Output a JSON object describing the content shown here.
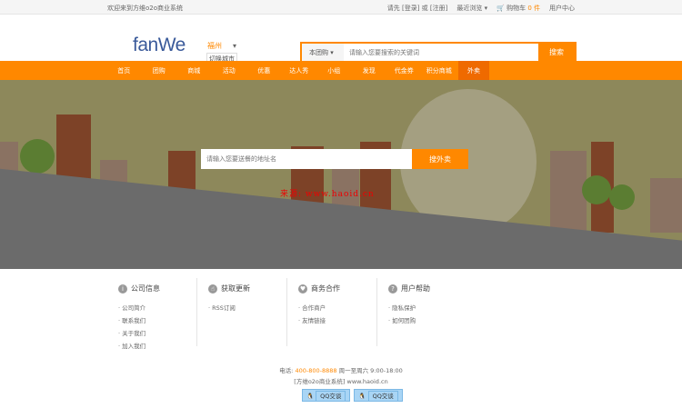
{
  "topbar": {
    "welcome": "欢迎来到方维o2o商业系统",
    "please": "请先",
    "login": "[登录]",
    "or": "或",
    "register": "[注册]",
    "recent": "最近浏览 ▾",
    "cart": "购物车",
    "cart_count": "0 件",
    "user_center": "用户中心"
  },
  "header": {
    "logo": "fanWe",
    "city": "福州",
    "switch_city": "切换城市",
    "search_type": "本团购 ▾",
    "search_placeholder": "请输入您要搜索的关键词",
    "search_button": "搜索"
  },
  "nav": [
    "首页",
    "团购",
    "商城",
    "活动",
    "优惠",
    "达人秀",
    "小组",
    "发现",
    "代金券",
    "积分商城",
    "外卖"
  ],
  "banner": {
    "placeholder": "请输入您要送餐的地址名",
    "button": "搜外卖",
    "watermark": "来源: www.haoid.cn"
  },
  "footer": {
    "columns": [
      {
        "title": "公司信息",
        "icon": "i",
        "items": [
          "公司简介",
          "联系我们",
          "关于我们",
          "加入我们"
        ]
      },
      {
        "title": "获取更新",
        "icon": "☝",
        "items": [
          "RSS订阅"
        ]
      },
      {
        "title": "商务合作",
        "icon": "♥",
        "items": [
          "合作商户",
          "友情链接"
        ]
      },
      {
        "title": "用户帮助",
        "icon": "?",
        "items": [
          "隐私保护",
          "如何团购"
        ]
      }
    ],
    "phone_label": "电话:",
    "phone": "400-800-8888",
    "hours": "周一至周六 9:00-18:00",
    "site": "[方维o2o商业系统] www.haoid.cn",
    "qq": [
      "QQ交谈",
      "QQ交谈"
    ]
  }
}
